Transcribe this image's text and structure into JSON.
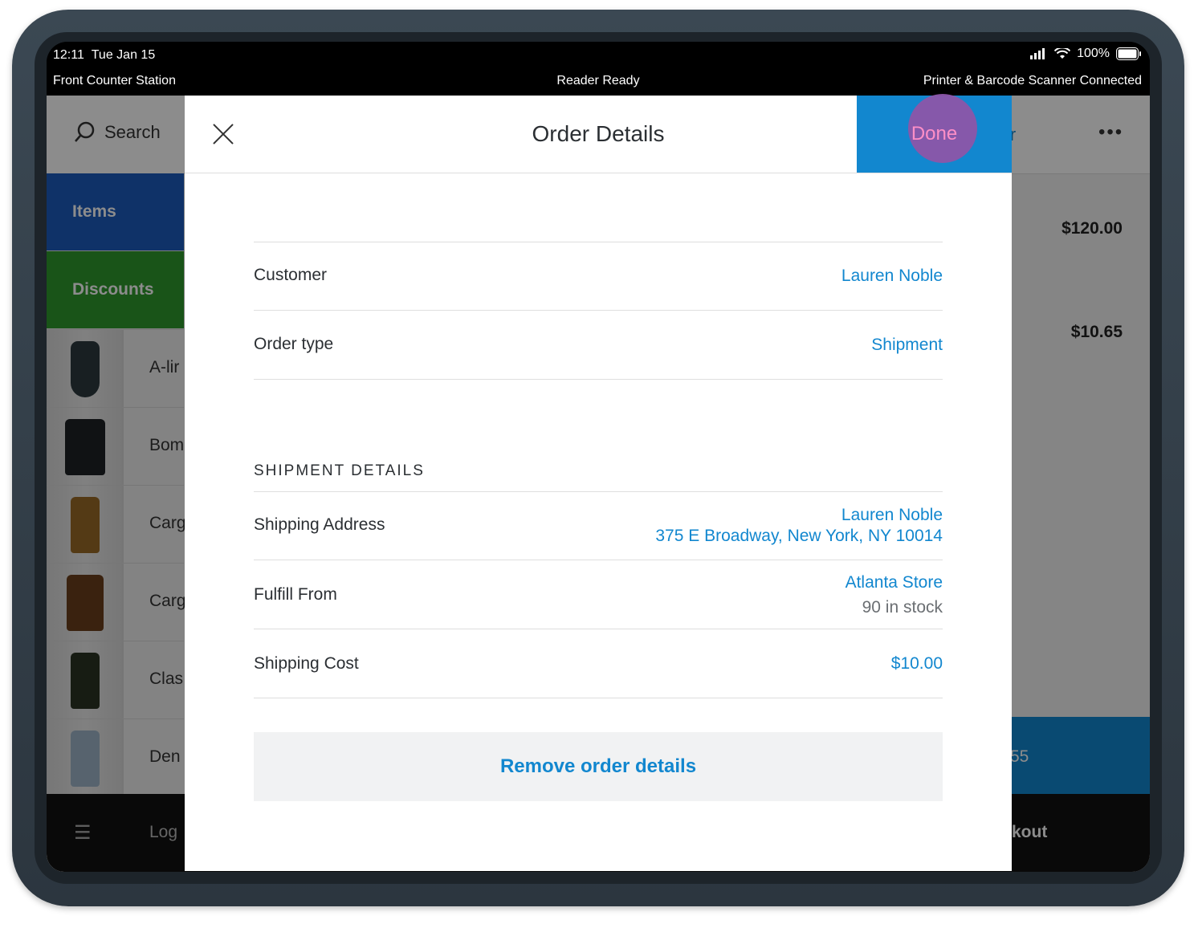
{
  "status_bar": {
    "time": "12:11",
    "date": "Tue Jan 15",
    "battery": "100%",
    "station": "Front Counter Station",
    "reader": "Reader Ready",
    "peripherals": "Printer & Barcode Scanner Connected"
  },
  "background_app": {
    "search_label": "Search",
    "customer_link": "stomer",
    "more": "•••",
    "tiles": {
      "items": "Items",
      "discounts": "Discounts"
    },
    "products": [
      "A-lir",
      "Bom",
      "Carg",
      "Carg",
      "Clas",
      "Den"
    ],
    "prices": [
      "$120.00",
      "$10.65"
    ],
    "charge_fragment": "55",
    "login_fragment": "Log",
    "checkout_fragment": "kout"
  },
  "modal": {
    "title": "Order Details",
    "done_label": "Done",
    "rows": {
      "customer_label": "Customer",
      "customer_value": "Lauren Noble",
      "order_type_label": "Order type",
      "order_type_value": "Shipment"
    },
    "shipment_section": "SHIPMENT DETAILS",
    "shipment": {
      "address_label": "Shipping Address",
      "address_name": "Lauren Noble",
      "address_line": "375 E Broadway, New York, NY 10014",
      "fulfill_label": "Fulfill From",
      "fulfill_store": "Atlanta Store",
      "fulfill_stock": "90 in stock",
      "cost_label": "Shipping Cost",
      "cost_value": "$10.00"
    },
    "remove_label": "Remove order details"
  },
  "colors": {
    "accent": "#1287cf",
    "items_tile": "#1d5bbd",
    "discounts_tile": "#2e9a2d",
    "tap_indicator": "#8d55a8"
  }
}
